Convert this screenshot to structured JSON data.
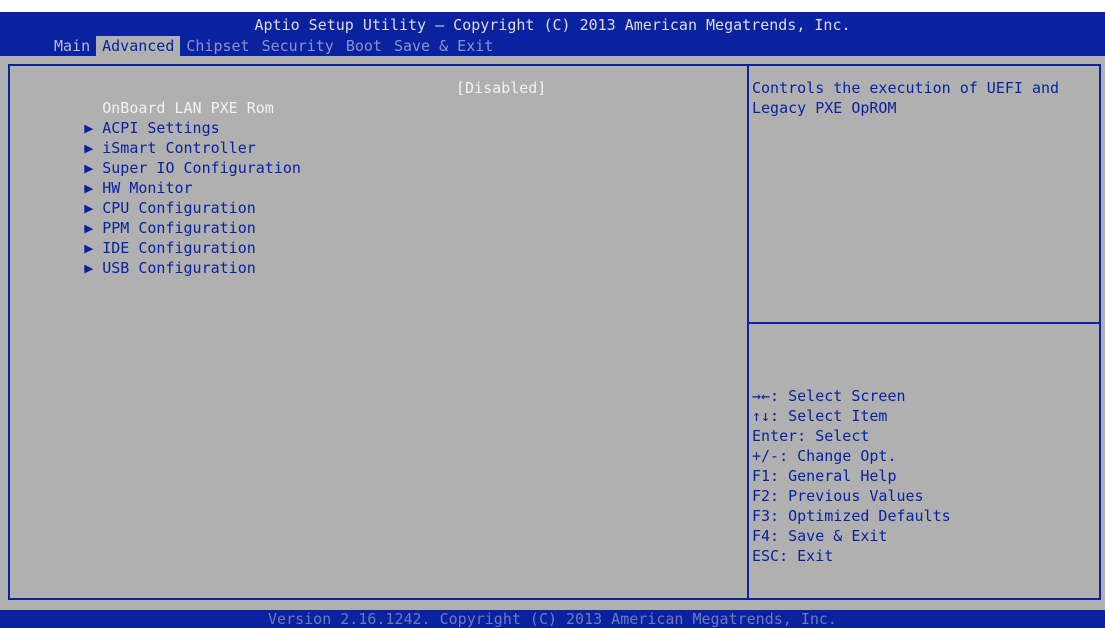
{
  "header": {
    "title": "Aptio Setup Utility – Copyright (C) 2013 American Megatrends, Inc.",
    "tabs": [
      {
        "label": "Main"
      },
      {
        "label": "Advanced"
      },
      {
        "label": "Chipset"
      },
      {
        "label": "Security"
      },
      {
        "label": "Boot"
      },
      {
        "label": "Save & Exit"
      }
    ],
    "active_tab": "Advanced"
  },
  "menu": {
    "items": [
      {
        "label": "OnBoard LAN PXE Rom",
        "value": "[Disabled]",
        "arrow": ""
      },
      {
        "label": "ACPI Settings",
        "arrow": "▶"
      },
      {
        "label": "iSmart Controller",
        "arrow": "▶"
      },
      {
        "label": "Super IO Configuration",
        "arrow": "▶"
      },
      {
        "label": "HW Monitor",
        "arrow": "▶"
      },
      {
        "label": "CPU Configuration",
        "arrow": "▶"
      },
      {
        "label": "PPM Configuration",
        "arrow": "▶"
      },
      {
        "label": "IDE Configuration",
        "arrow": "▶"
      },
      {
        "label": "USB Configuration",
        "arrow": "▶"
      }
    ]
  },
  "help": {
    "text": "Controls the execution of UEFI and Legacy PXE OpROM"
  },
  "keys": [
    "→←: Select Screen",
    "↑↓: Select Item",
    "Enter: Select",
    "+/-: Change Opt.",
    "F1: General Help",
    "F2: Previous Values",
    "F3: Optimized Defaults",
    "F4: Save & Exit",
    "ESC: Exit"
  ],
  "footer": {
    "text": "Version 2.16.1242. Copyright (C) 2013 American Megatrends, Inc."
  },
  "colors": {
    "bios_blue": "#0a22a0",
    "bios_gray": "#b0b0b0",
    "highlight_white": "#f2f2f2"
  }
}
